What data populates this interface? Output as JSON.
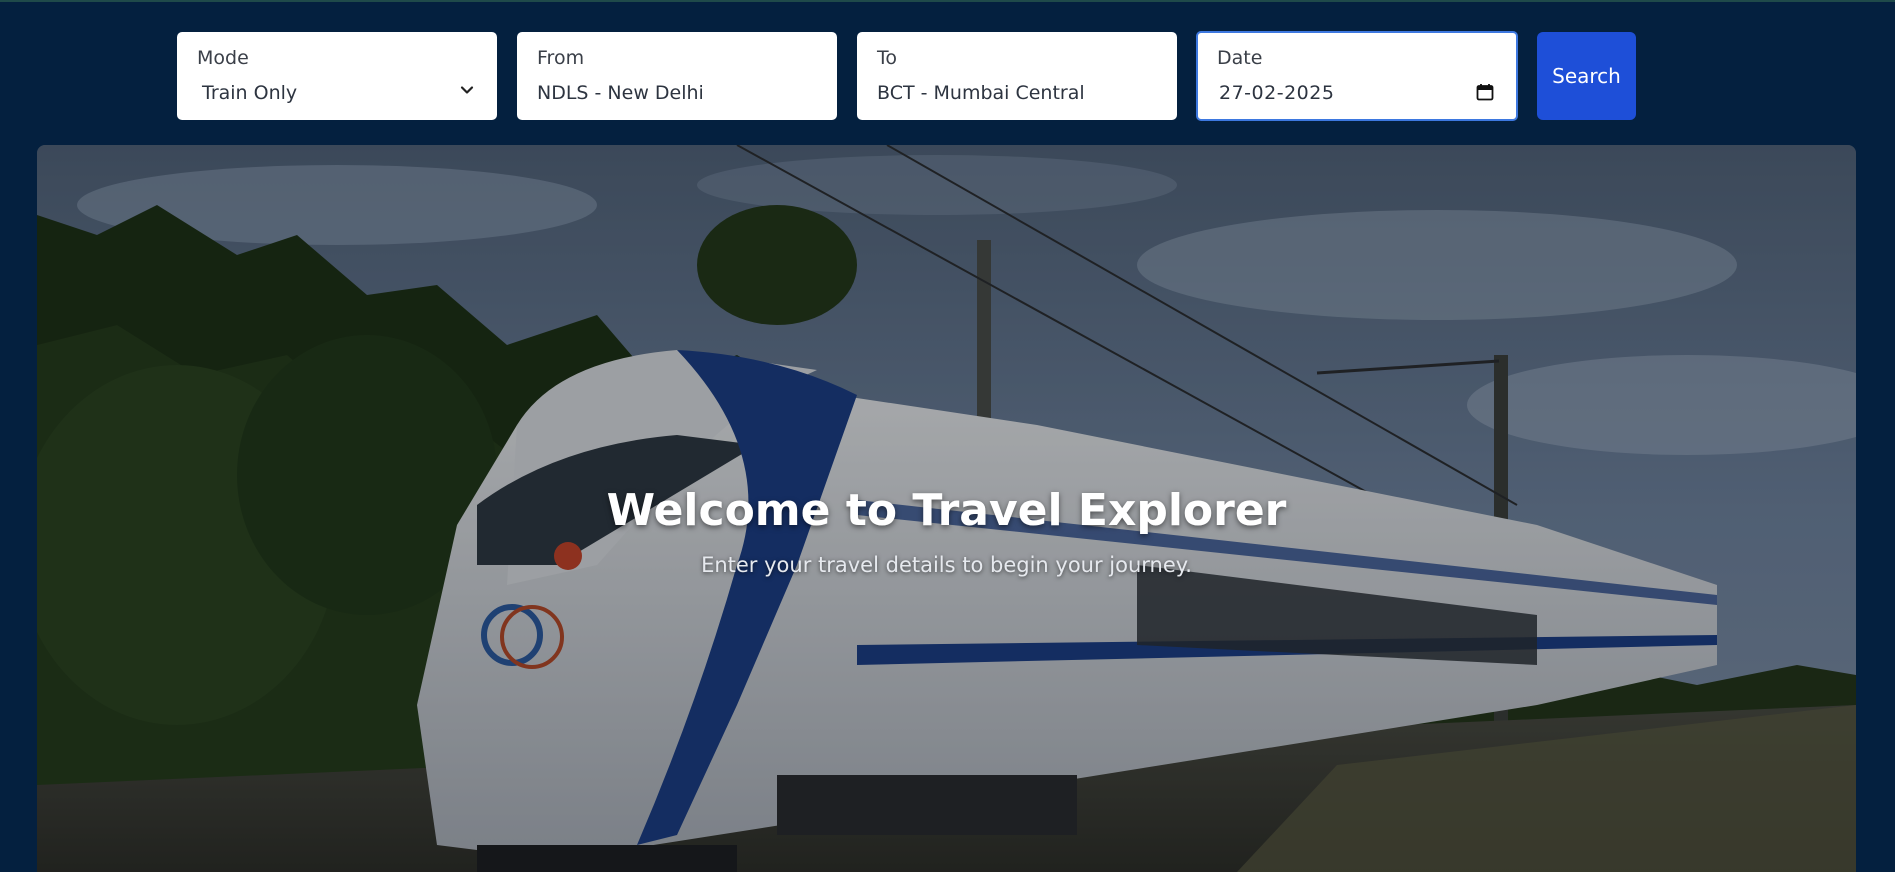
{
  "search": {
    "mode": {
      "label": "Mode",
      "value": "Train Only",
      "icon": "chevron-down-icon"
    },
    "from": {
      "label": "From",
      "value": "NDLS - New Delhi"
    },
    "to": {
      "label": "To",
      "value": "BCT - Mumbai Central"
    },
    "date": {
      "label": "Date",
      "value": "27-02-2025",
      "icon": "calendar-icon"
    },
    "button_label": "Search"
  },
  "hero": {
    "title": "Welcome to Travel Explorer",
    "subtitle": "Enter your travel details to begin your journey.",
    "image": "train-photo"
  },
  "colors": {
    "page_bg": "#04203f",
    "button_bg": "#1e4fd8",
    "focus_border": "#3d78e0"
  }
}
